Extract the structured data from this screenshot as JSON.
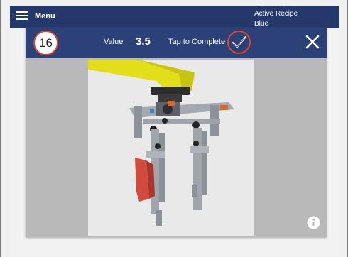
{
  "header": {
    "menu_label": "Menu",
    "recipe_label": "Active Recipe",
    "recipe_value": "Blue",
    "menu_icon": "hamburger-menu-icon"
  },
  "modal": {
    "step_number": "16",
    "value_label": "Value",
    "value": "3.5",
    "complete_label": "Tap to Complete",
    "complete_icon": "checkmark-icon",
    "close_icon": "close-icon",
    "info_icon": "info-icon",
    "image_subject": "robot-arm-gripper-image"
  },
  "colors": {
    "header_bg": "#24386b",
    "modal_header_bg": "#2b4178",
    "accent_ring": "#e0452b",
    "robot_yellow": "#e6e21b"
  }
}
